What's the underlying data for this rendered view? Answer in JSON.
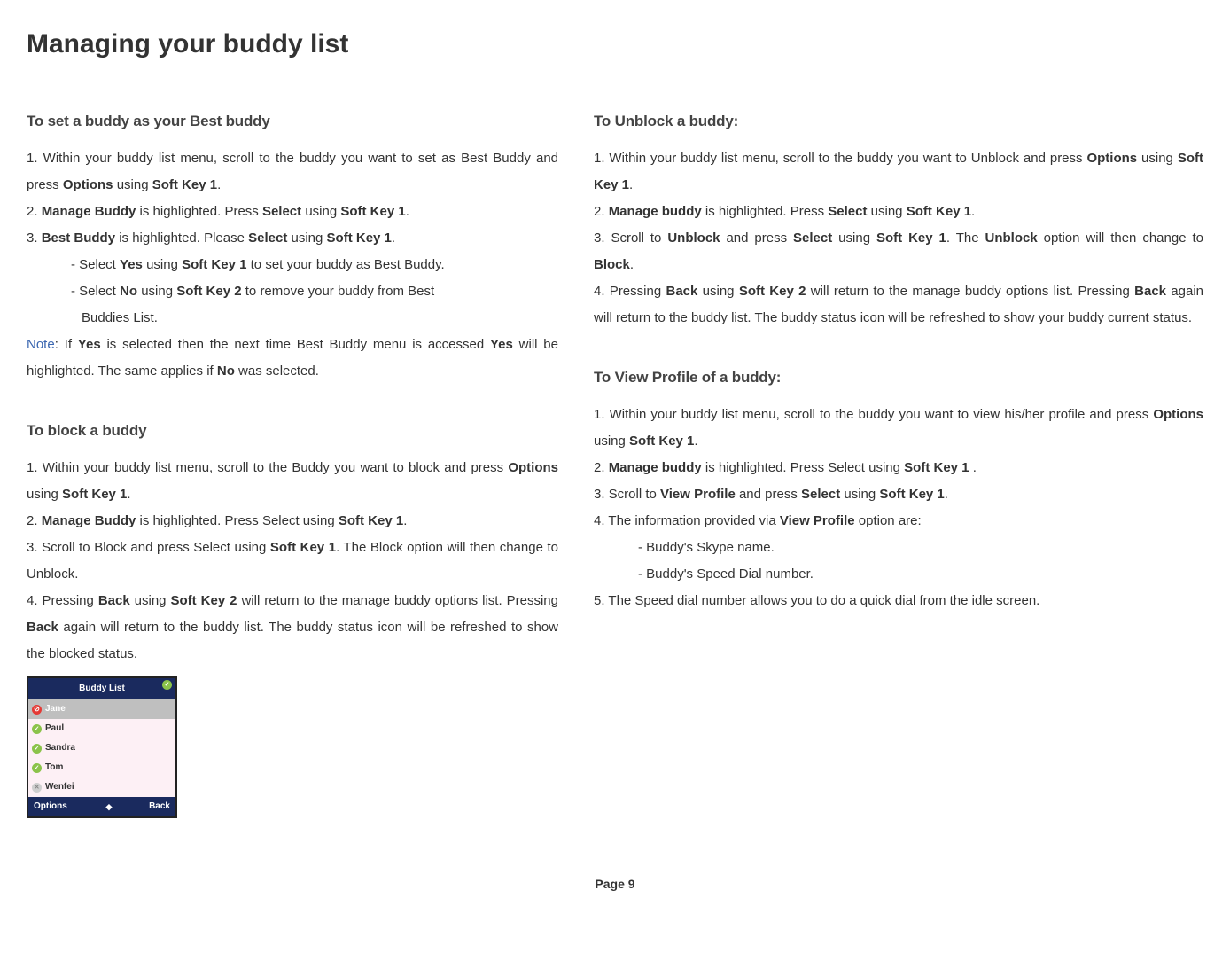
{
  "title": "Managing your buddy list",
  "left": {
    "section1": {
      "heading": "To set a buddy as your Best buddy",
      "p1a": "1. Within your buddy list menu, scroll to the buddy you want to set as Best Buddy and press ",
      "p1b": "Options",
      "p1c": " using ",
      "p1d": "Soft Key 1",
      "p1e": ".",
      "p2a": "2. ",
      "p2b": "Manage Buddy",
      "p2c": " is highlighted. Press ",
      "p2d": "Select",
      "p2e": " using ",
      "p2f": "Soft Key 1",
      "p2g": ".",
      "p3a": "3. ",
      "p3b": "Best Buddy",
      "p3c": " is highlighted. Please ",
      "p3d": "Select",
      "p3e": " using ",
      "p3f": "Soft Key 1",
      "p3g": ".",
      "i1a": "- Select ",
      "i1b": "Yes",
      "i1c": " using ",
      "i1d": "Soft Key 1",
      "i1e": " to set your buddy as Best Buddy.",
      "i2a": "- Select ",
      "i2b": "No",
      "i2c": " using ",
      "i2d": "Soft Key 2",
      "i2e": " to remove your buddy from Best",
      "i3": "Buddies List.",
      "note_label": "Note",
      "note_a": ": If ",
      "note_b": "Yes",
      "note_c": " is selected then the next time Best Buddy menu is accessed ",
      "note_d": "Yes",
      "note_e": " will be highlighted. The same applies if ",
      "note_f": "No",
      "note_g": " was selected."
    },
    "section2": {
      "heading": "To block a buddy",
      "p1a": "1. Within your buddy list menu, scroll to the Buddy you want to block and press ",
      "p1b": "Options",
      "p1c": " using ",
      "p1d": "Soft Key 1",
      "p1e": ".",
      "p2a": "2. ",
      "p2b": "Manage Buddy",
      "p2c": " is highlighted. Press Select using ",
      "p2d": "Soft Key 1",
      "p2e": ".",
      "p3a": "3. Scroll to Block and press Select using ",
      "p3b": "Soft Key 1",
      "p3c": ". The Block option will then change to Unblock.",
      "p4a": "4. Pressing ",
      "p4b": "Back",
      "p4c": " using ",
      "p4d": "Soft Key 2",
      "p4e": " will return to the manage buddy options list. Pressing ",
      "p4f": "Back",
      "p4g": " again will return to the buddy list. The buddy status icon will be refreshed to show the blocked status."
    }
  },
  "right": {
    "section1": {
      "heading": "To Unblock a buddy:",
      "p1a": "1. Within your buddy list menu, scroll to the buddy you want to Unblock and press ",
      "p1b": "Options",
      "p1c": " using ",
      "p1d": "Soft Key 1",
      "p1e": ".",
      "p2a": "2. ",
      "p2b": "Manage buddy",
      "p2c": " is highlighted. Press ",
      "p2d": "Select",
      "p2e": " using ",
      "p2f": "Soft Key 1",
      "p2g": ".",
      "p3a": "3. Scroll to ",
      "p3b": "Unblock",
      "p3c": " and press ",
      "p3d": "Select",
      "p3e": " using ",
      "p3f": "Soft Key 1",
      "p3g": ". The ",
      "p3h": "Unblock",
      "p3i": " option will then change to ",
      "p3j": "Block",
      "p3k": ".",
      "p4a": "4. Pressing ",
      "p4b": "Back",
      "p4c": " using ",
      "p4d": "Soft Key 2",
      "p4e": " will return to the manage buddy options list. Pressing ",
      "p4f": "Back",
      "p4g": " again will return to the buddy list. The buddy status icon will be refreshed to show your buddy current status."
    },
    "section2": {
      "heading": "To View Profile of a buddy:",
      "p1a": "1. Within your buddy list menu, scroll to the buddy you want to view his/her profile and press ",
      "p1b": "Options",
      "p1c": " using ",
      "p1d": "Soft Key 1",
      "p1e": ".",
      "p2a": "2. ",
      "p2b": "Manage buddy",
      "p2c": " is highlighted. Press Select using ",
      "p2d": "Soft Key 1",
      "p2e": " .",
      "p3a": "3. Scroll to ",
      "p3b": "View Profile",
      "p3c": " and press ",
      "p3d": "Select",
      "p3e": " using ",
      "p3f": "Soft Key 1",
      "p3g": ".",
      "p4a": "4. The information provided via ",
      "p4b": "View Profile",
      "p4c": " option are:",
      "i1": "- Buddy's Skype name.",
      "i2": "- Buddy's Speed Dial number.",
      "p5": " 5. The Speed dial number allows you to do a quick dial from the idle screen."
    }
  },
  "widget": {
    "title": "Buddy List",
    "rows": [
      {
        "name": "Jane",
        "status": "blocked",
        "selected": true
      },
      {
        "name": "Paul",
        "status": "online",
        "selected": false
      },
      {
        "name": "Sandra",
        "status": "online",
        "selected": false
      },
      {
        "name": "Tom",
        "status": "online",
        "selected": false
      },
      {
        "name": "Wenfei",
        "status": "offline",
        "selected": false
      }
    ],
    "left_soft": "Options",
    "right_soft": "Back"
  },
  "page": "Page 9"
}
